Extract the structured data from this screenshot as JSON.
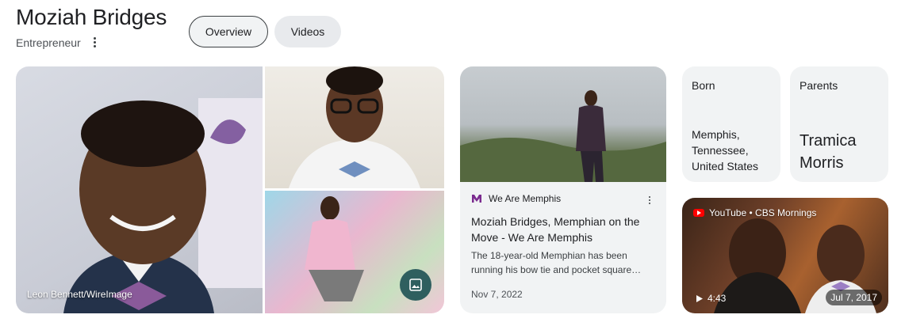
{
  "entity": {
    "name": "Moziah Bridges",
    "description": "Entrepreneur"
  },
  "tabs": [
    {
      "label": "Overview",
      "active": true
    },
    {
      "label": "Videos",
      "active": false
    }
  ],
  "images": {
    "credit": "Leon Bennett/WireImage",
    "gallery_icon": "image-gallery-icon"
  },
  "news": {
    "source": "We Are Memphis",
    "source_logo": "M",
    "title": "Moziah Bridges, Memphian on the Move - We Are Memphis",
    "snippet": "The 18-year-old Memphian has been running his bow tie and pocket square…",
    "date": "Nov 7, 2022"
  },
  "facts": {
    "born_label": "Born",
    "born_value": "Memphis, Tennessee, United States",
    "parents_label": "Parents",
    "parents_value": "Tramica Morris"
  },
  "video": {
    "source": "YouTube • CBS Mornings",
    "duration": "4:43",
    "date": "Jul 7, 2017"
  },
  "colors": {
    "text": "#202124",
    "muted": "#4d5156",
    "card_bg": "#f1f3f4",
    "chip_bg": "#e8eaed",
    "logo_purple": "#7b2c8f",
    "youtube_red": "#ff0000"
  }
}
